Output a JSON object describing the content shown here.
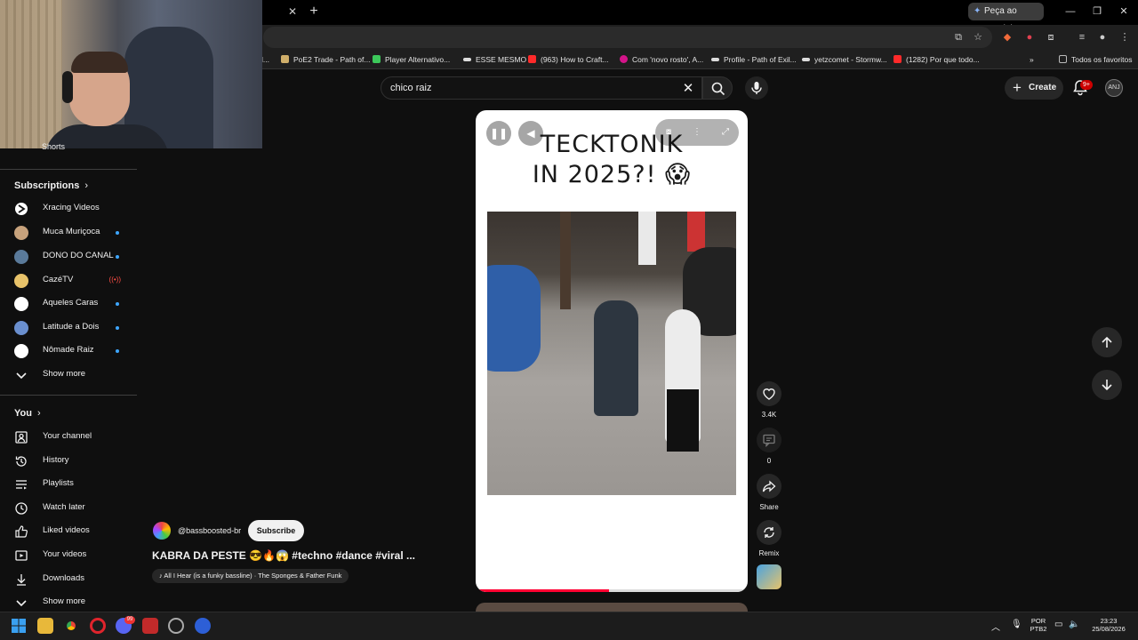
{
  "browser": {
    "gemini_label": "Peça ao Gemini",
    "bookmarks": [
      {
        "label": "l...",
        "color": "#888888"
      },
      {
        "label": "PoE2 Trade - Path of...",
        "color": "#cfae6a"
      },
      {
        "label": "Player Alternativo...",
        "color": "#3cc85a"
      },
      {
        "label": "ESSE MESMO",
        "color": "#dddddd"
      },
      {
        "label": "(963) How to Craft...",
        "color": "#ff2a2a"
      },
      {
        "label": "Com 'novo rosto', A...",
        "color": "#d4148a"
      },
      {
        "label": "Profile - Path of Exil...",
        "color": "#dddddd"
      },
      {
        "label": "yetzcomet - Stormw...",
        "color": "#dddddd"
      },
      {
        "label": "(1282) Por que todo...",
        "color": "#ff2a2a"
      },
      {
        "label": "Todos os favoritos",
        "color": "#bbbbbb"
      }
    ]
  },
  "header": {
    "search_value": "chico raiz",
    "create_label": "Create",
    "notif_badge": "9+",
    "avatar_text": "ANJ"
  },
  "sidebar": {
    "shorts_label": "Shorts",
    "subscriptions_heading": "Subscriptions",
    "subscriptions": [
      {
        "label": "Xracing Videos",
        "new": false,
        "live": false,
        "color": "#ffffff"
      },
      {
        "label": "Muca Muriçoca",
        "new": true,
        "live": false,
        "color": "#c7a27c"
      },
      {
        "label": "DONO DO CANAL",
        "new": true,
        "live": false,
        "color": "#5a7a9a"
      },
      {
        "label": "CazéTV",
        "new": false,
        "live": true,
        "color": "#e8c36a"
      },
      {
        "label": "Aqueles Caras",
        "new": true,
        "live": false,
        "color": "#ffffff"
      },
      {
        "label": "Latitude a Dois",
        "new": true,
        "live": false,
        "color": "#6a8fcf"
      },
      {
        "label": "Nômade Raiz",
        "new": true,
        "live": false,
        "color": "#ffffff"
      }
    ],
    "show_more_1": "Show more",
    "you_heading": "You",
    "you_items": [
      {
        "label": "Your channel",
        "icon": "user-square-icon"
      },
      {
        "label": "History",
        "icon": "history-icon"
      },
      {
        "label": "Playlists",
        "icon": "playlists-icon"
      },
      {
        "label": "Watch later",
        "icon": "clock-icon"
      },
      {
        "label": "Liked videos",
        "icon": "thumbs-up-icon"
      },
      {
        "label": "Your videos",
        "icon": "video-icon"
      },
      {
        "label": "Downloads",
        "icon": "download-icon"
      }
    ],
    "show_more_2": "Show more"
  },
  "player": {
    "overlay_title_line1": "TECKTONIK",
    "overlay_title_line2": "IN 2025?! 😱",
    "progress": 0.49
  },
  "actions": {
    "like_count": "3.4K",
    "comment_count": "0",
    "share_label": "Share",
    "remix_label": "Remix"
  },
  "video": {
    "channel": "@bassboosted-br",
    "subscribe_label": "Subscribe",
    "title": "KABRA DA PESTE 😎🔥😱 #techno #dance #viral ...",
    "music": "♪ All I Hear (is a funky bassline) · The Sponges & Father Funk"
  },
  "taskbar": {
    "lang": "POR",
    "layout": "PTB2",
    "time": "23:23",
    "date": "25/08/2026",
    "discord_badge": "99"
  }
}
